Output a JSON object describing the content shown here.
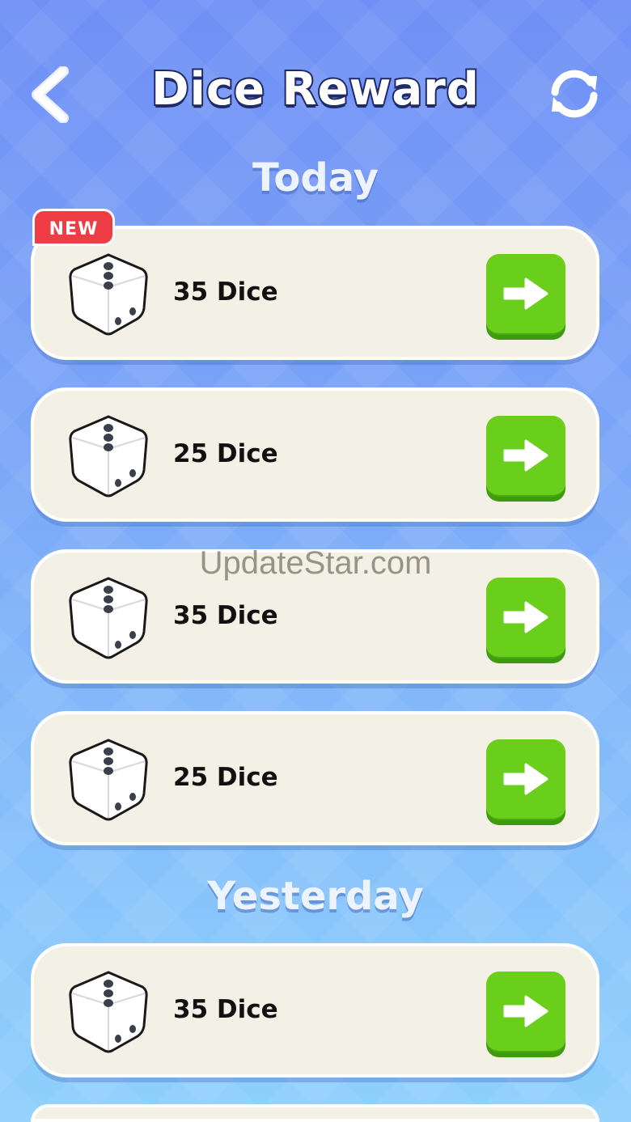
{
  "header": {
    "title": "Dice Reward",
    "back_icon": "back-chevron-icon",
    "refresh_icon": "refresh-icon"
  },
  "sections": [
    {
      "title": "Today",
      "items": [
        {
          "label": "35 Dice",
          "badge": "NEW"
        },
        {
          "label": "25 Dice"
        },
        {
          "label": "35 Dice"
        },
        {
          "label": "25 Dice"
        }
      ]
    },
    {
      "title": "Yesterday",
      "items": [
        {
          "label": "35 Dice"
        }
      ]
    }
  ],
  "watermark": "UpdateStar.com",
  "colors": {
    "button_green": "#69cf1b",
    "badge_red": "#ee3d45",
    "card_bg": "#f3f1e6",
    "title_outline": "#1f2a66"
  }
}
